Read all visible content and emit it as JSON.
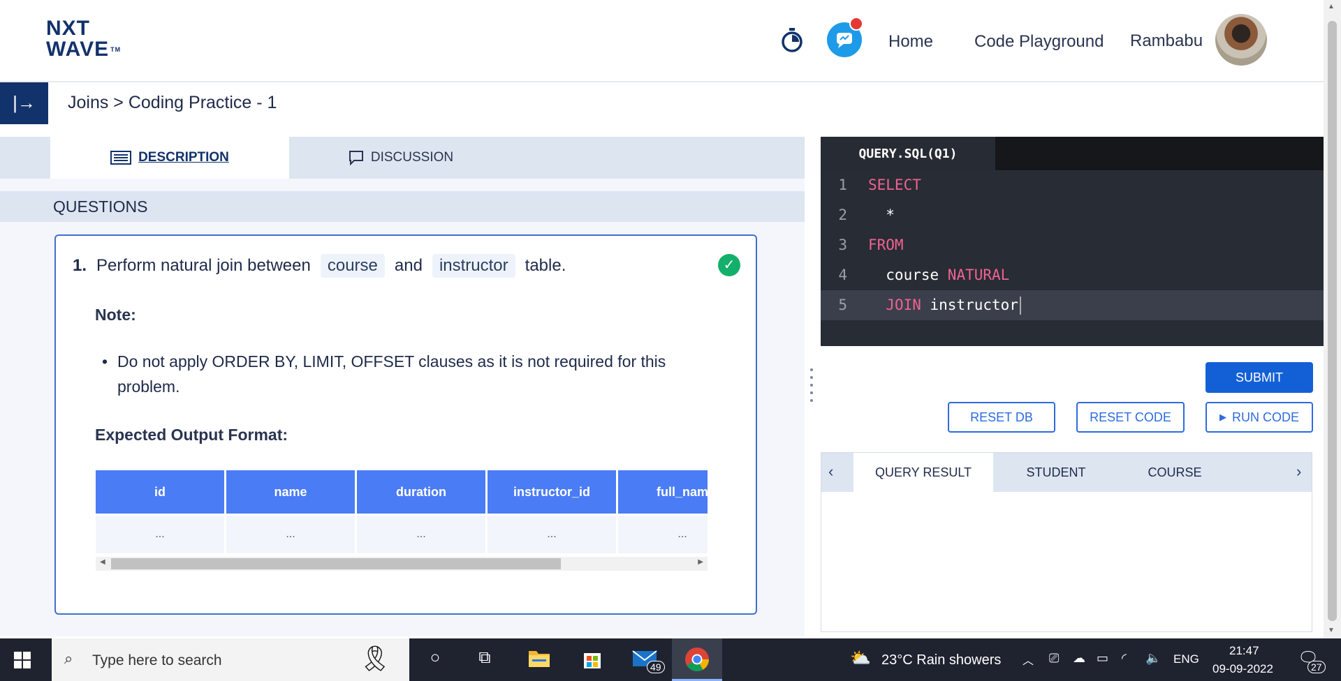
{
  "header": {
    "logo_line1": "NXT",
    "logo_line2": "WAVE",
    "logo_tm": "TM",
    "nav_home": "Home",
    "nav_code_playground": "Code Playground",
    "user_name": "Rambabu"
  },
  "breadcrumb": {
    "text": "Joins > Coding Practice - 1"
  },
  "left_tabs": {
    "description": "DESCRIPTION",
    "discussion": "DISCUSSION"
  },
  "questions": {
    "heading": "QUESTIONS",
    "number": "1.",
    "text_before": "Perform natural join between",
    "chip1": "course",
    "text_mid": "and",
    "chip2": "instructor",
    "text_after": "table.",
    "note_label": "Note:",
    "note_bullet": "Do not apply ORDER BY, LIMIT, OFFSET clauses as it is not required for this problem.",
    "expected_label": "Expected Output Format:",
    "columns": [
      "id",
      "name",
      "duration",
      "instructor_id",
      "full_nam"
    ],
    "row": [
      "...",
      "...",
      "...",
      "...",
      "..."
    ]
  },
  "editor": {
    "tab_label": "QUERY.SQL(Q1)",
    "lines": [
      {
        "n": "1",
        "kw": "SELECT",
        "rest": ""
      },
      {
        "n": "2",
        "kw": "",
        "rest": "  *"
      },
      {
        "n": "3",
        "kw": "FROM",
        "rest": ""
      },
      {
        "n": "4",
        "pre": "  course ",
        "kw": "NATURAL",
        "rest": ""
      },
      {
        "n": "5",
        "pre": "  ",
        "kw": "JOIN",
        "rest": " instructor"
      }
    ]
  },
  "buttons": {
    "submit": "SUBMIT",
    "reset_db": "RESET DB",
    "reset_code": "RESET CODE",
    "run_code": "RUN CODE"
  },
  "result_tabs": {
    "query_result": "QUERY RESULT",
    "student": "STUDENT",
    "course": "COURSE"
  },
  "taskbar": {
    "search_placeholder": "Type here to search",
    "mail_badge": "49",
    "weather": "23°C  Rain showers",
    "lang": "ENG",
    "time": "21:47",
    "date": "09-09-2022",
    "notif_badge": "27"
  },
  "colors": {
    "brand_navy": "#12326b",
    "table_header_blue": "#4a7cf5",
    "keyword_pink": "#f06292",
    "submit_blue": "#1360d6",
    "success_green": "#13b06b"
  }
}
